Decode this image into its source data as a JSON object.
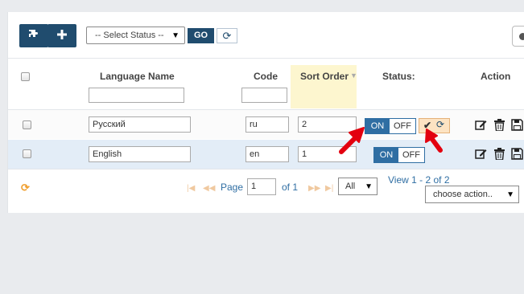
{
  "toolbar": {
    "puzzle_icon": "puzzle-icon",
    "add_icon": "plus-icon",
    "status_select": "-- Select Status --",
    "go_label": "GO",
    "refresh_icon": "refresh-icon"
  },
  "table": {
    "headers": {
      "language_name": "Language Name",
      "code": "Code",
      "sort_order": "Sort Order",
      "status": "Status:",
      "action": "Action"
    },
    "rows": [
      {
        "name": "Русский",
        "code": "ru",
        "sort": "2",
        "on": "ON",
        "off": "OFF"
      },
      {
        "name": "English",
        "code": "en",
        "sort": "1",
        "on": "ON",
        "off": "OFF"
      }
    ],
    "save_status": {
      "check": "✔",
      "refresh": "⟳"
    }
  },
  "pagination": {
    "page_label": "Page",
    "page_value": "1",
    "of_label": "of 1",
    "per_page": "All",
    "view_text": "View 1 - 2 of 2",
    "choose_action": "choose action.."
  },
  "colors": {
    "primary": "#204c6e",
    "toggle_on": "#2f6ea3",
    "sort_highlight": "#fdf6cf",
    "row_highlight": "#e3edf7",
    "arrow": "#e3000f"
  }
}
